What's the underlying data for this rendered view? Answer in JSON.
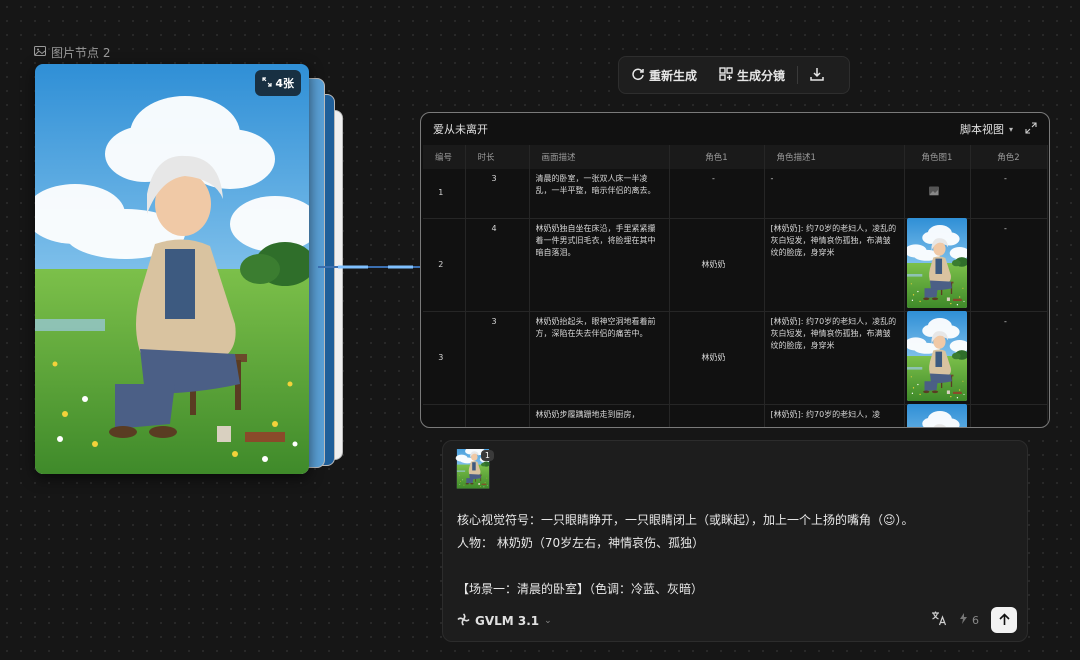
{
  "node": {
    "title": "图片节点 2",
    "count_badge": "4张",
    "icon": "image-icon"
  },
  "toolbar": {
    "regenerate_label": "重新生成",
    "storyboard_label": "生成分镜",
    "download_icon": "download-icon"
  },
  "script_panel": {
    "title": "爱从未离开",
    "view_label": "脚本视图",
    "columns": [
      "编号",
      "时长",
      "画面描述",
      "角色1",
      "角色描述1",
      "角色图1",
      "角色2"
    ],
    "rows": [
      {
        "num": "1",
        "duration": "3",
        "description": "清晨的卧室，一张双人床一半凌乱，一半平整，暗示伴侣的离去。",
        "role1": "-",
        "role_desc1": "-",
        "role_img1": "placeholder",
        "role2": "-"
      },
      {
        "num": "2",
        "duration": "4",
        "description": "林奶奶独自坐在床沿，手里紧紧攥着一件男式旧毛衣，将脸埋在其中暗自落泪。",
        "role1": "林奶奶",
        "role_desc1": "[林奶奶]: 约70岁的老妇人，凌乱的灰白短发，神情哀伤孤独，布满皱纹的脸庞，身穿米",
        "role_img1": "image",
        "role2": "-"
      },
      {
        "num": "3",
        "duration": "3",
        "description": "林奶奶抬起头，眼神空洞地看着前方，深陷在失去伴侣的痛苦中。",
        "role1": "林奶奶",
        "role_desc1": "[林奶奶]: 约70岁的老妇人，凌乱的灰白短发，神情哀伤孤独，布满皱纹的脸庞，身穿米",
        "role_img1": "image",
        "role2": "-"
      },
      {
        "num": "",
        "duration": "",
        "description": "林奶奶步履蹒跚地走到厨房，",
        "role1": "",
        "role_desc1": "[林奶奶]: 约70岁的老妇人，凌",
        "role_img1": "image",
        "role2": ""
      }
    ]
  },
  "chat": {
    "attachment_count": "1",
    "lines": [
      "核心视觉符号：一只眼睛睁开，一只眼睛闭上（或眯起），加上一个上扬的嘴角（😉）。",
      "人物： 林奶奶（70岁左右，神情哀伤、孤独）",
      "",
      "【场景一：清晨的卧室】（色调：冷蓝、灰暗）"
    ],
    "model": "GVLM 3.1",
    "credits": "6"
  },
  "colors": {
    "background": "#161616",
    "panel_border": "#7a7a7a",
    "connector": "#4a90e2"
  }
}
